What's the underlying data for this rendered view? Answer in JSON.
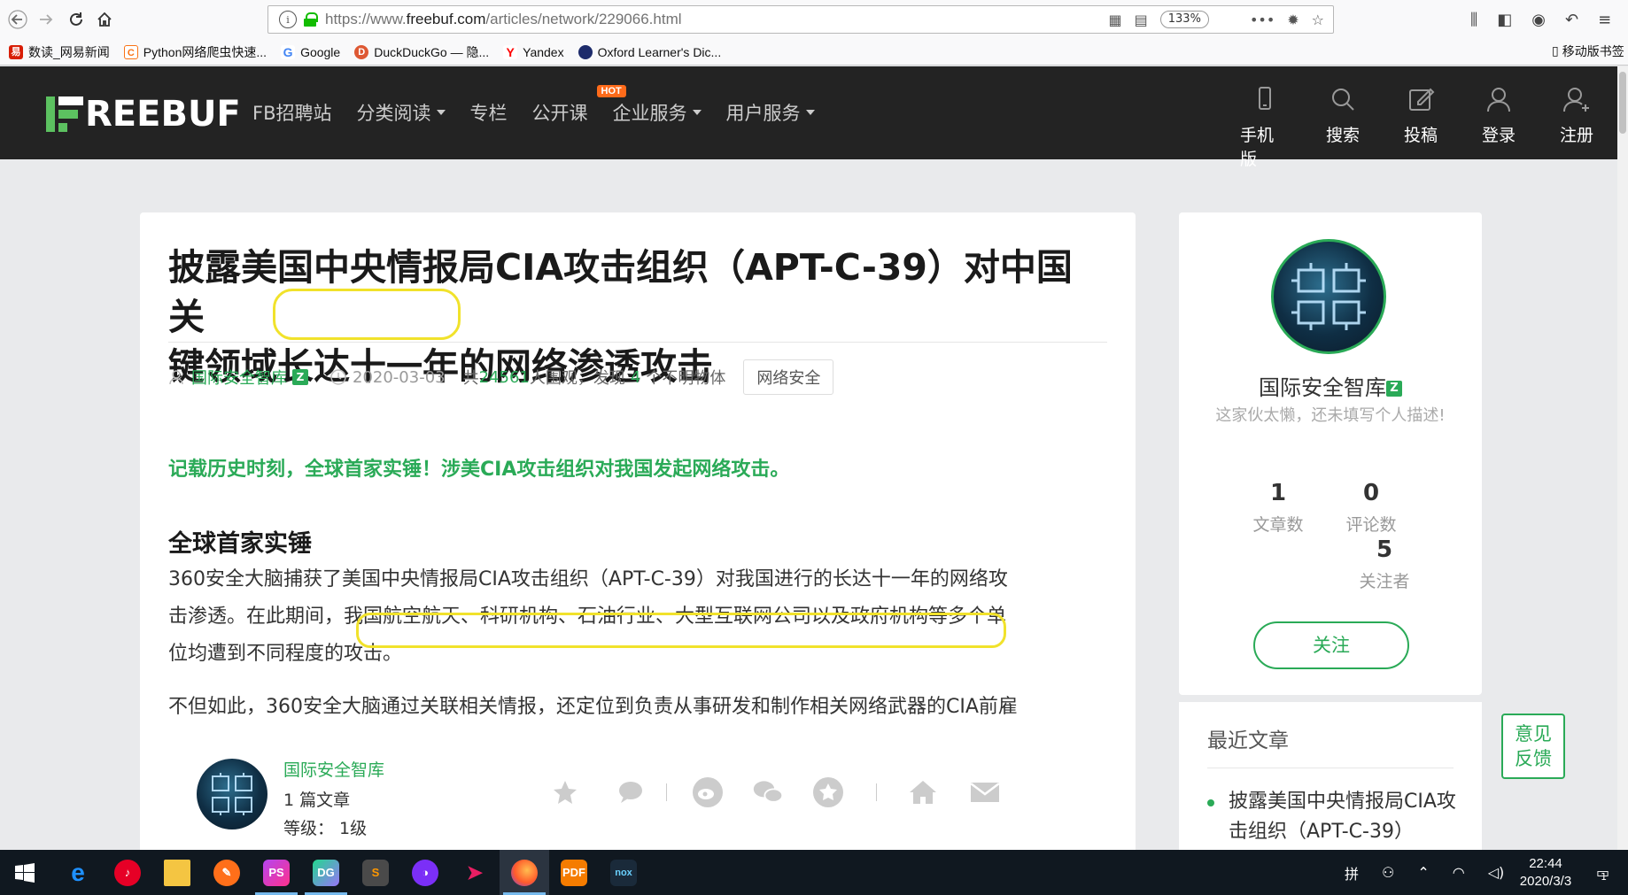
{
  "browser": {
    "url_prefix": "https://www.",
    "url_domain": "freebuf.com",
    "url_path": "/articles/network/229066.html",
    "zoom": "133%",
    "bookmarks": [
      {
        "label": "数读_网易新闻",
        "icon": "netease-icon",
        "color": "#d81e06"
      },
      {
        "label": "Python网络爬虫快速...",
        "icon": "csdn-icon",
        "color": "#f97316"
      },
      {
        "label": "Google",
        "icon": "google-icon",
        "color": "#4285f4"
      },
      {
        "label": "DuckDuckGo — 隐...",
        "icon": "duckduckgo-icon",
        "color": "#de5833"
      },
      {
        "label": "Yandex",
        "icon": "yandex-icon",
        "color": "#ff0000"
      },
      {
        "label": "Oxford Learner's Dic...",
        "icon": "oxford-icon",
        "color": "#1d2b6b"
      }
    ],
    "mobile_bookmarks": "移动版书签"
  },
  "site": {
    "logo_text": "REEBUF",
    "nav": [
      {
        "label": "FB招聘站",
        "dropdown": false
      },
      {
        "label": "分类阅读",
        "dropdown": true
      },
      {
        "label": "专栏",
        "dropdown": false
      },
      {
        "label": "公开课",
        "dropdown": false
      },
      {
        "label": "企业服务",
        "dropdown": true,
        "badge": "HOT"
      },
      {
        "label": "用户服务",
        "dropdown": true
      }
    ],
    "user_nav": [
      {
        "label": "手机版",
        "icon": "phone-icon"
      },
      {
        "label": "搜索",
        "icon": "search-icon"
      },
      {
        "label": "投稿",
        "icon": "edit-icon"
      },
      {
        "label": "登录",
        "icon": "user-icon"
      },
      {
        "label": "注册",
        "icon": "add-user-icon"
      }
    ]
  },
  "article": {
    "title_line1": "披露美国中央情报局CIA攻击组织（APT-C-39）对中国关",
    "title_line2_pre": "键领域",
    "title_line2_hl": "长达十一年",
    "title_line2_post": "的网络渗透攻击",
    "author": "国际安全智库",
    "verified_badge": "Z",
    "date": "2020-03-03",
    "views_pre": "共",
    "views": "24561",
    "views_mid": "人围观，发现",
    "ufo": "4",
    "views_post": "个不明物体",
    "tag": "网络安全",
    "lead": "记载历史时刻，全球首家实锤！涉美CIA攻击组织对我国发起网络攻击。",
    "heading": "全球首家实锤",
    "p1_line1": "360安全大脑捕获了美国中央情报局CIA攻击组织（APT-C-39）对我国进行的长达十一年的网络攻",
    "p1_line2_pre": "击渗透。在此期间，",
    "p1_line2_hl": "我国航空航天、科研机构、石油行业、大型互联网公司以及政府机构等",
    "p1_line2_post": "多个单",
    "p1_line3": "位均遭到不同程度的攻击。",
    "p2_line1": "不但如此，360安全大脑通过关联相关情报，还定位到负责从事研发和制作相关网络武器的CIA前雇"
  },
  "author_bar": {
    "name": "国际安全智库",
    "articles": "1 篇文章",
    "level": "等级：  1级",
    "actions": [
      "star-icon",
      "comment-icon",
      "weibo-icon",
      "wechat-icon",
      "favorite-icon",
      "home-icon",
      "mail-icon"
    ]
  },
  "sidebar": {
    "name": "国际安全智库",
    "badge": "Z",
    "desc": "这家伙太懒，还未填写个人描述!",
    "stats": [
      {
        "num": "1",
        "label": "文章数"
      },
      {
        "num": "0",
        "label": "评论数"
      },
      {
        "num": "5",
        "label": "关注者"
      }
    ],
    "follow": "关注",
    "recent_title": "最近文章",
    "recent_item": "披露美国中央情报局CIA攻击组织（APT-C-39）",
    "feedback": "意见\n反馈"
  },
  "taskbar": {
    "time": "22:44",
    "date": "2020/3/3",
    "ime": "拼",
    "notifications": "1"
  },
  "colors": {
    "accent": "#2aaa57",
    "header_bg": "#232323",
    "highlight": "#f1e22b"
  }
}
